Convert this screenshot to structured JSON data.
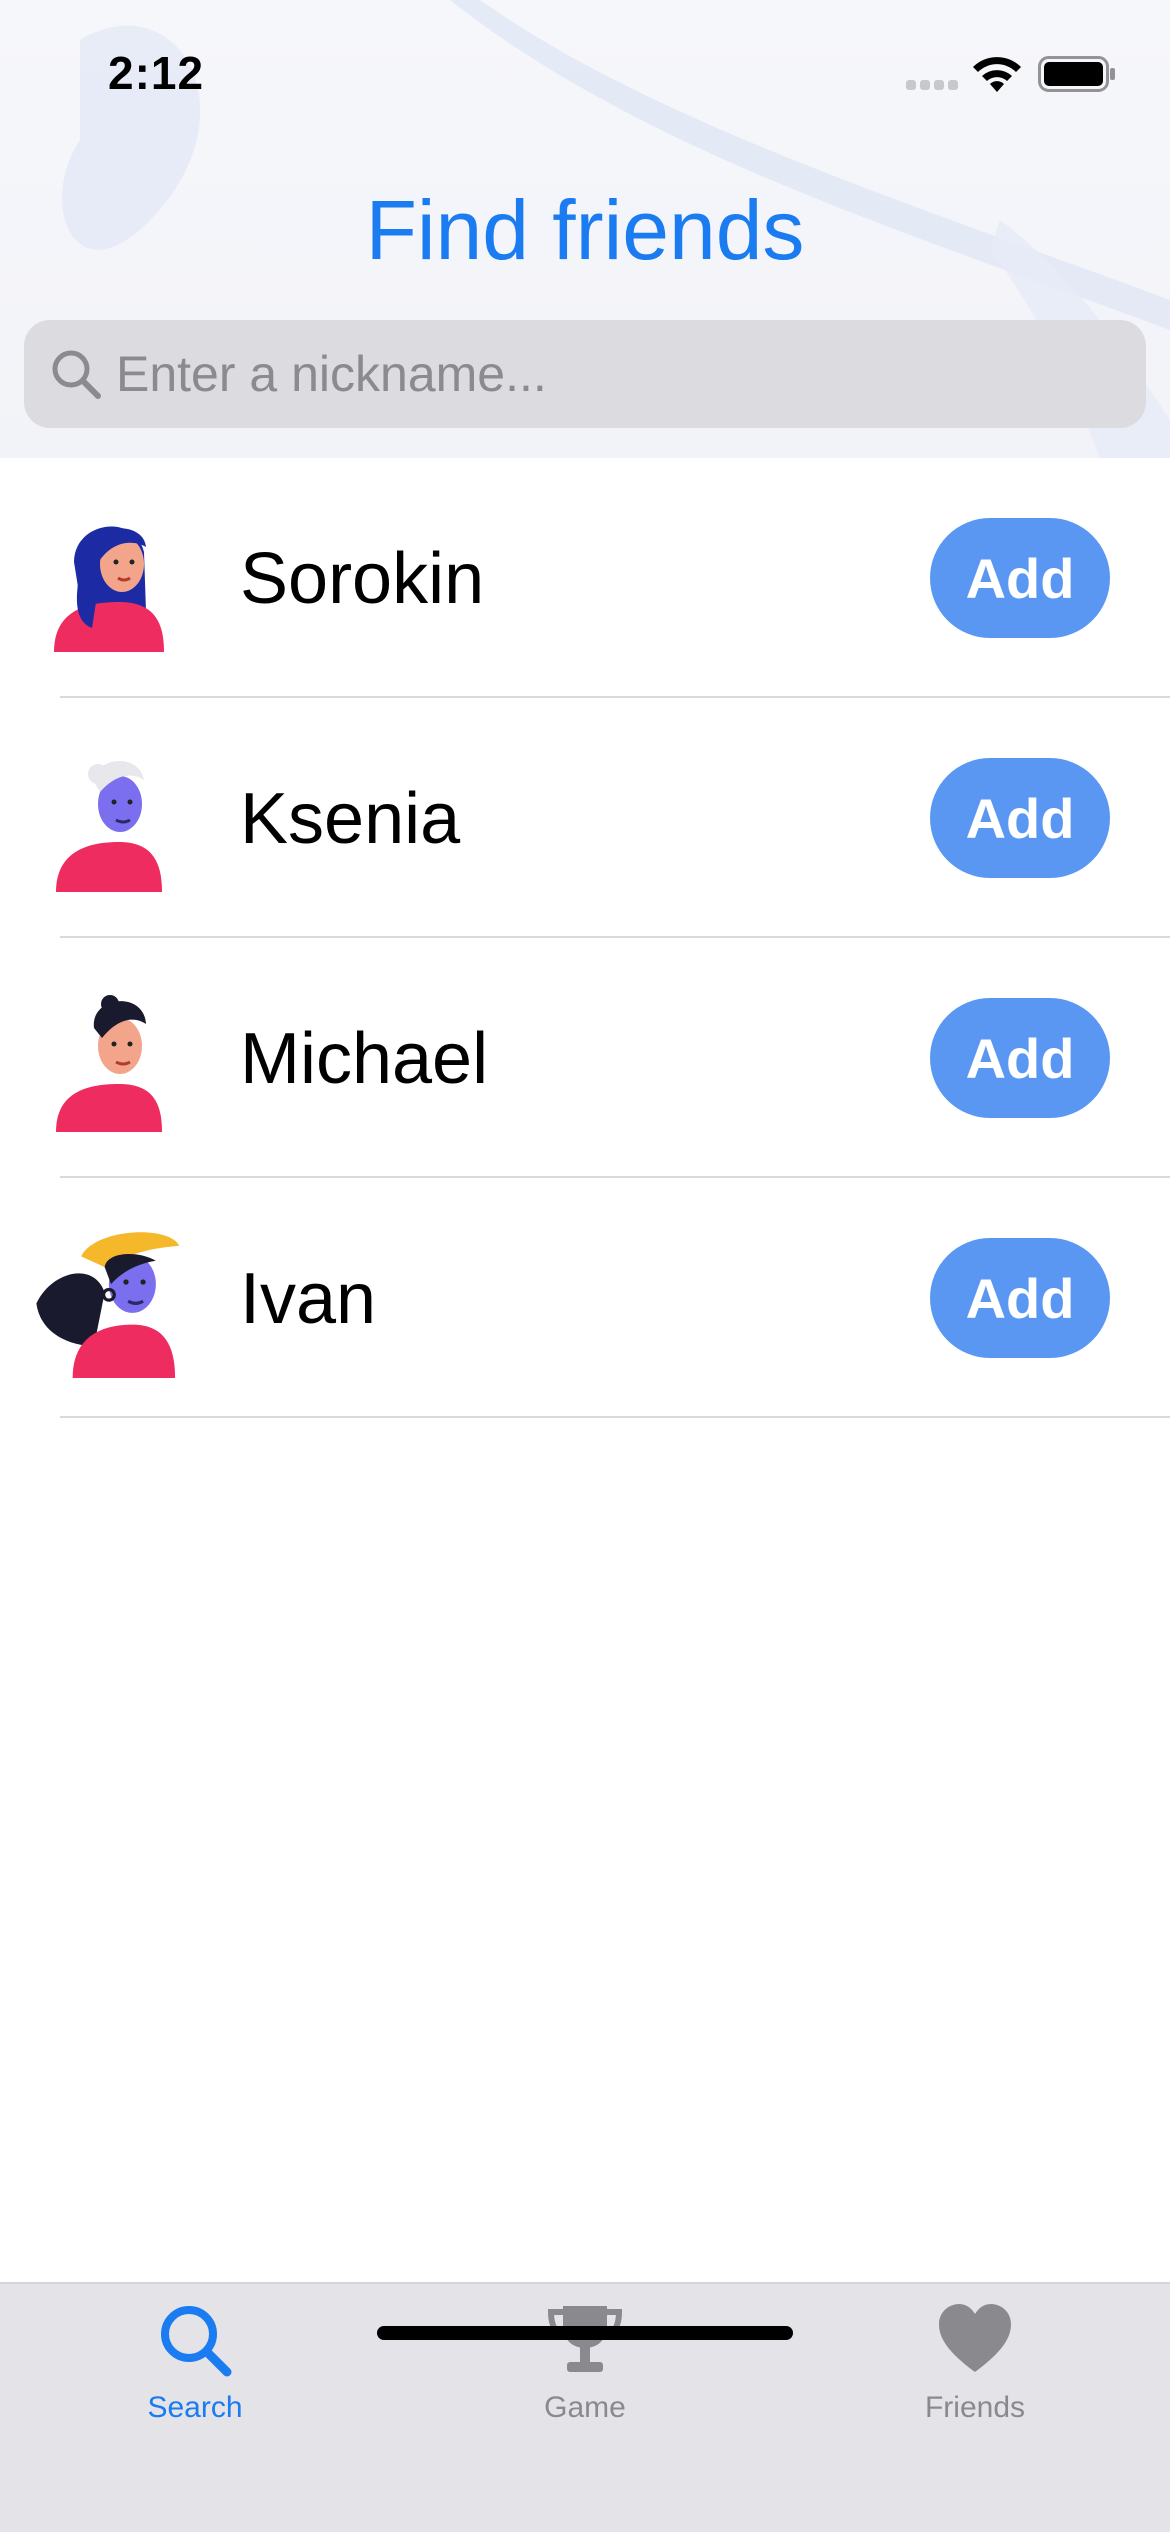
{
  "status_bar": {
    "time": "2:12"
  },
  "header": {
    "title": "Find friends",
    "title_color": "#1a7cf0"
  },
  "search": {
    "placeholder": "Enter a nickname...",
    "value": "",
    "icon": "search-icon"
  },
  "users": [
    {
      "name": "Sorokin",
      "action_label": "Add",
      "avatar": "avatar-woman-blue-hair-icon"
    },
    {
      "name": "Ksenia",
      "action_label": "Add",
      "avatar": "avatar-man-gray-hair-icon"
    },
    {
      "name": "Michael",
      "action_label": "Add",
      "avatar": "avatar-man-dark-hair-icon"
    },
    {
      "name": "Ivan",
      "action_label": "Add",
      "avatar": "avatar-woman-yellow-hat-icon"
    }
  ],
  "tabs": [
    {
      "label": "Search",
      "icon": "search-icon",
      "active": true
    },
    {
      "label": "Game",
      "icon": "trophy-icon",
      "active": false
    },
    {
      "label": "Friends",
      "icon": "heart-icon",
      "active": false
    }
  ],
  "colors": {
    "accent": "#1a7cf0",
    "button": "#5a97f2",
    "tab_bar": "#e3e3e8",
    "search_bar": "#dcdce0"
  }
}
